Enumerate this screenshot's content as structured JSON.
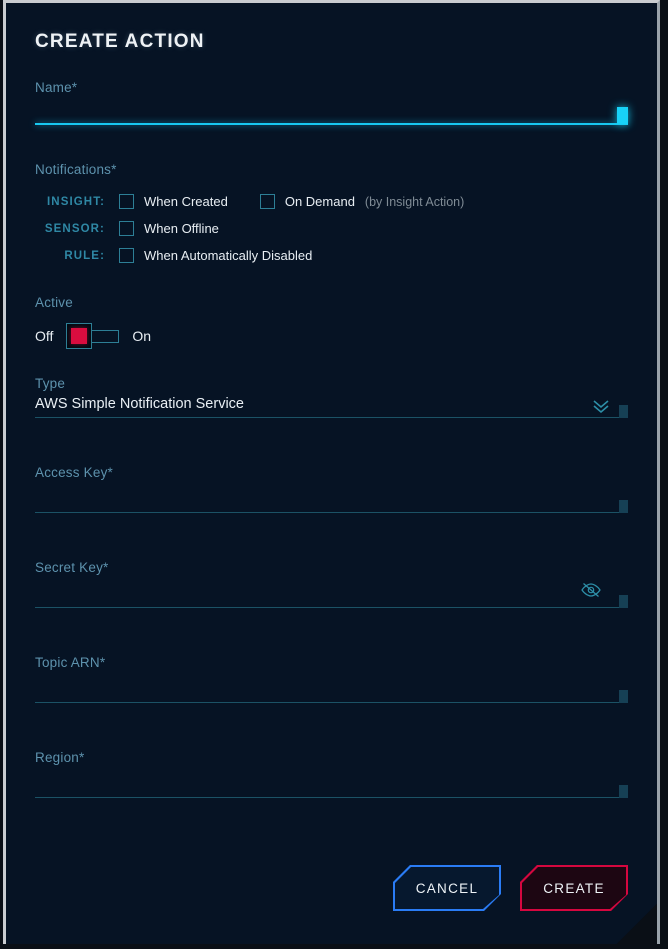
{
  "dialog": {
    "title": "CREATE ACTION"
  },
  "fields": {
    "name": {
      "label": "Name*",
      "value": "",
      "focused": true
    },
    "type": {
      "label": "Type",
      "value": "AWS Simple Notification Service",
      "chevron_icon": "chevron-double-down-icon"
    },
    "access_key": {
      "label": "Access Key*",
      "value": ""
    },
    "secret_key": {
      "label": "Secret Key*",
      "value": "",
      "reveal_icon": "eye-off-icon"
    },
    "topic_arn": {
      "label": "Topic ARN*",
      "value": ""
    },
    "region": {
      "label": "Region*",
      "value": ""
    }
  },
  "notifications": {
    "label": "Notifications*",
    "rows": [
      {
        "category": "INSIGHT:",
        "options": [
          {
            "label": "When Created",
            "checked": false,
            "note": ""
          },
          {
            "label": "On Demand",
            "checked": false,
            "note": "(by Insight Action)"
          }
        ]
      },
      {
        "category": "SENSOR:",
        "options": [
          {
            "label": "When Offline",
            "checked": false,
            "note": ""
          }
        ]
      },
      {
        "category": "RULE:",
        "options": [
          {
            "label": "When Automatically Disabled",
            "checked": false,
            "note": ""
          }
        ]
      }
    ]
  },
  "active": {
    "label": "Active",
    "off_label": "Off",
    "on_label": "On",
    "state": "off"
  },
  "buttons": {
    "cancel": "CANCEL",
    "create": "CREATE"
  },
  "colors": {
    "background": "#061324",
    "accent_cyan": "#18c8f0",
    "accent_teal": "#2d7f96",
    "label_blue": "#5d92ad",
    "cancel_blue": "#2a7cf5",
    "create_red": "#d5073f",
    "toggle_red": "#d90d3f"
  }
}
